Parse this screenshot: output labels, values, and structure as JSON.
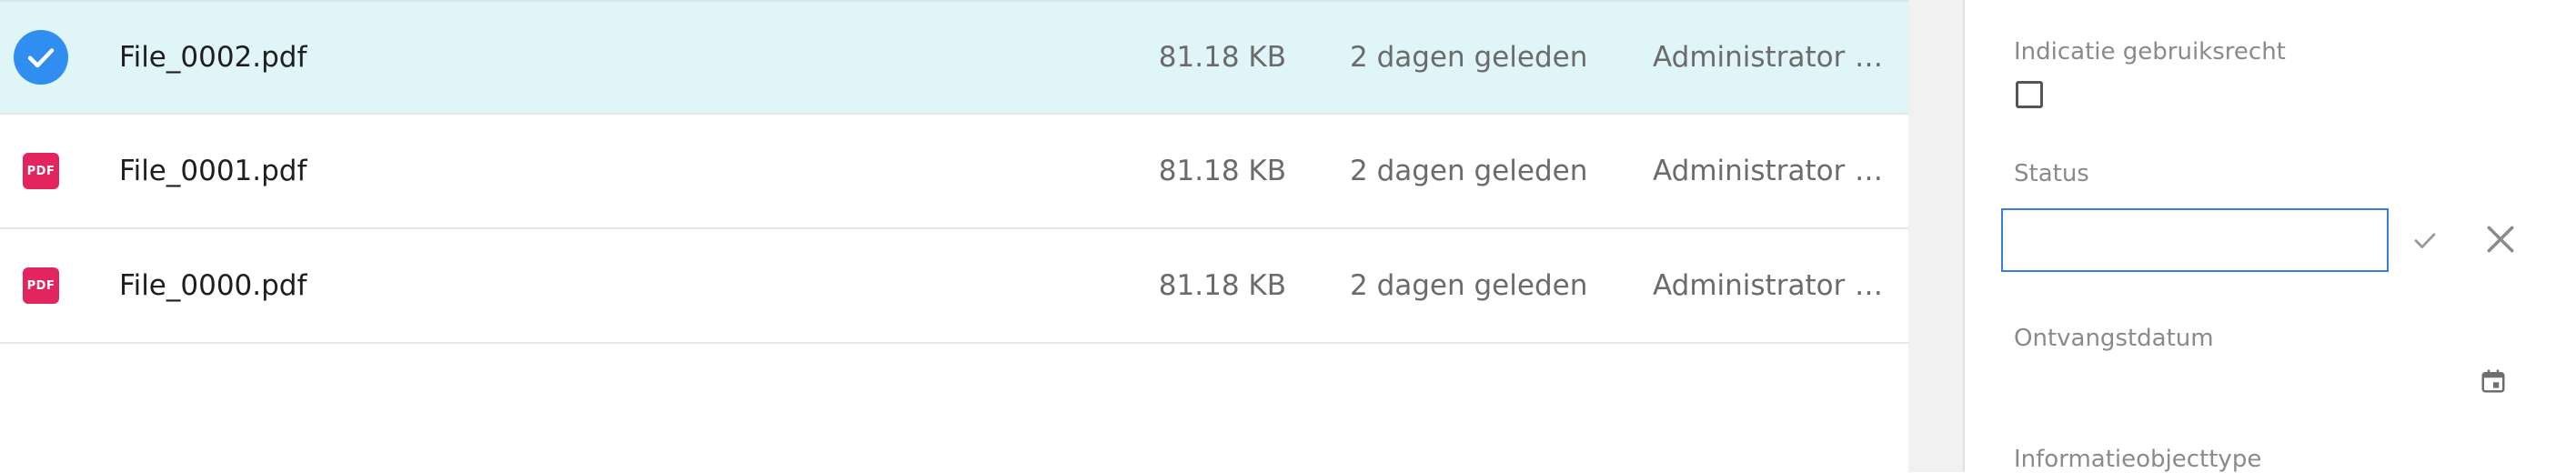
{
  "files": [
    {
      "name": "File_0002.pdf",
      "size": "81.18 KB",
      "modified": "2 dagen geleden",
      "owner": "Administrator",
      "selected": true,
      "icon": "check-circle-icon"
    },
    {
      "name": "File_0001.pdf",
      "size": "81.18 KB",
      "modified": "2 dagen geleden",
      "owner": "Administrator",
      "selected": false,
      "icon": "pdf-icon"
    },
    {
      "name": "File_0000.pdf",
      "size": "81.18 KB",
      "modified": "2 dagen geleden",
      "owner": "Administrator",
      "selected": false,
      "icon": "pdf-icon"
    }
  ],
  "pdf_badge_text": "PDF",
  "ellipsis": "…",
  "details": {
    "usage_rights_label": "Indicatie gebruiksrecht",
    "usage_rights_checked": false,
    "status_label": "Status",
    "status_value": "",
    "received_date_label": "Ontvangstdatum",
    "info_object_type_label": "Informatieobjecttype"
  },
  "colors": {
    "selected_row_bg": "#dff5f7",
    "check_blue": "#2f8ef0",
    "pdf_red": "#e2245f",
    "input_border": "#3b7dd8"
  }
}
